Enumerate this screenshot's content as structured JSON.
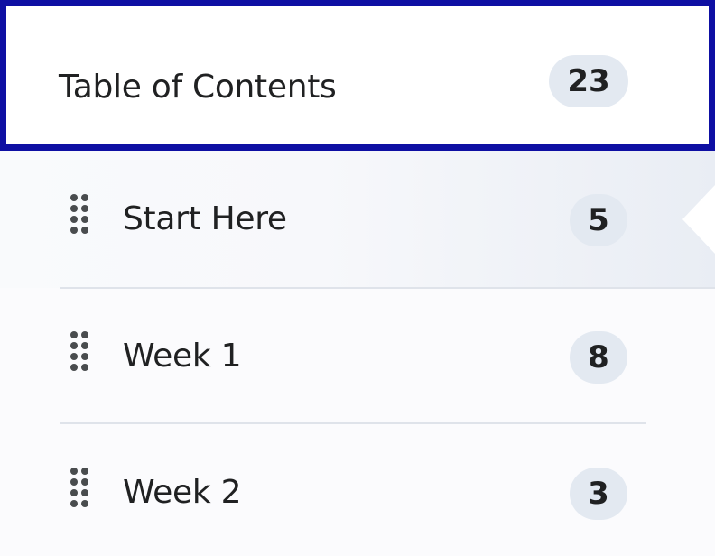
{
  "toc": {
    "title": "Table of Contents",
    "count": "23"
  },
  "modules": [
    {
      "label": "Start Here",
      "count": "5",
      "selected": true
    },
    {
      "label": "Week 1",
      "count": "8",
      "selected": false
    },
    {
      "label": "Week 2",
      "count": "3",
      "selected": false
    }
  ],
  "icons": {
    "drag_handle": "drag-handle-icon"
  },
  "colors": {
    "focus_border": "#0e0fa3",
    "badge_background": "#e3e9f1",
    "text": "#202122",
    "divider": "#dfe3ea"
  }
}
